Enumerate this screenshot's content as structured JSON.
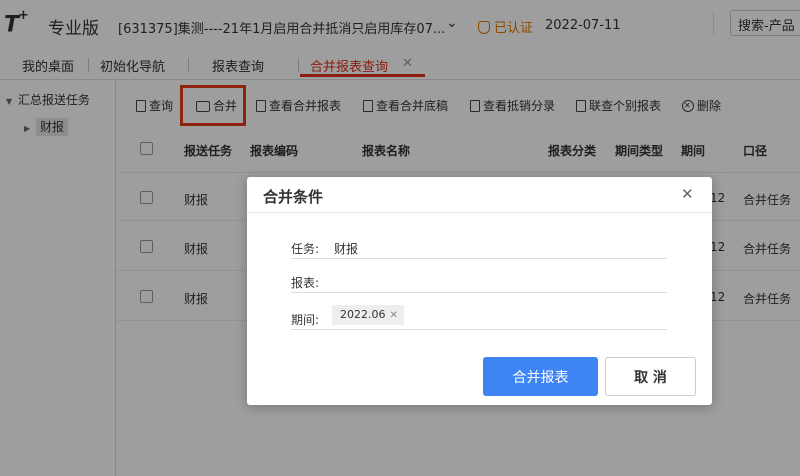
{
  "header": {
    "logo": "T",
    "logo_plus": "+",
    "edition": "专业版",
    "company": "[631375]集测----21年1月启用合并抵消只启用库存07...",
    "certified": "已认证",
    "date": "2022-07-11",
    "search_placeholder": "搜索-产品"
  },
  "tabs": [
    {
      "label": "我的桌面"
    },
    {
      "label": "初始化导航"
    },
    {
      "label": "报表查询"
    },
    {
      "label": "合并报表查询",
      "active": true
    }
  ],
  "sidebar": {
    "root": "汇总报送任务",
    "child": "财报"
  },
  "toolbar": {
    "query": "查询",
    "merge": "合并",
    "view_merged": "查看合并报表",
    "view_base": "查看合并底稿",
    "view_offset": "查看抵销分录",
    "view_individual": "联查个别报表",
    "delete": "删除"
  },
  "table": {
    "columns": [
      "报送任务",
      "报表编码",
      "报表名称",
      "报表分类",
      "期间类型",
      "期间",
      "口径"
    ],
    "rows": [
      {
        "task": "财报",
        "period_partial": "12",
        "scope": "合并任务"
      },
      {
        "task": "财报",
        "period_partial": "12",
        "scope": "合并任务"
      },
      {
        "task": "财报",
        "period_partial": "12",
        "scope": "合并任务"
      }
    ]
  },
  "dialog": {
    "title": "合并条件",
    "task_label": "任务:",
    "task_value": "财报",
    "report_label": "报表:",
    "report_value": "",
    "period_label": "期间:",
    "period_tag": "2022.06",
    "confirm": "合并报表",
    "cancel": "取 消"
  },
  "colors": {
    "accent_red": "#e0301e",
    "primary_blue": "#3e85f3",
    "certified_orange": "#e07a00"
  }
}
